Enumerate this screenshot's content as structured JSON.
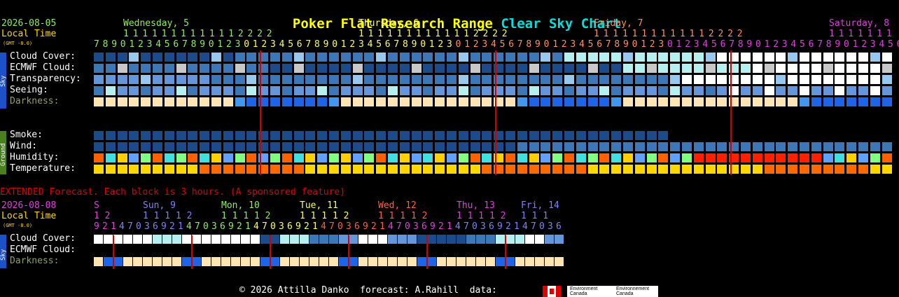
{
  "title": {
    "name": "Poker Flat Research Range",
    "suffix": "Clear Sky Chart",
    "name_color": "#ffff00",
    "suffix_color": "#00e0e0"
  },
  "date": "2026-08-05",
  "local_time_label": "Local Time",
  "gmt": "(GMT -8.0)",
  "days": [
    {
      "label": "Wednesday, 5",
      "color": "#90ee60"
    },
    {
      "label": "Thursday, 6",
      "color": "#ffff60"
    },
    {
      "label": "Friday, 7",
      "color": "#ff9060"
    },
    {
      "label": "Saturday, 8",
      "color": "#e040e0"
    }
  ],
  "hours_tens": [
    "1 1 1 1 1 1 1 1 1 1 1 1 2 2 2 2",
    "1 1 1 1 1 1 1 1 1 1 1 1 2 2 2 2",
    "1 1 1 1 1 1 1 1 1 1 1 1 2 2 2 2",
    "1 1 1 1 1 1 1"
  ],
  "hours_ones": "78901234567890123012345678901234567890123012345678901234567890123012345678901234567890123456",
  "sky_sidebar_label": "Sky",
  "ground_sidebar_label": "Ground",
  "rows_sky": [
    "Cloud Cover:",
    "ECMWF Cloud:",
    "Transparency:",
    "Seeing:",
    "Darkness:"
  ],
  "rows_ground": [
    "Smoke:",
    "Wind:",
    "Humidity:",
    "Temperature:"
  ],
  "extended_note": "EXTENDED Forecast. Each block is 3 hours. (A sponsored feature)",
  "ext_date": "2026-08-08",
  "ext_days": [
    {
      "label": "S",
      "color": "#e040e0"
    },
    {
      "label": "Sun, 9",
      "color": "#8080ff"
    },
    {
      "label": "Mon, 10",
      "color": "#90ee60"
    },
    {
      "label": "Tue, 11",
      "color": "#ffff60"
    },
    {
      "label": "Wed, 12",
      "color": "#ff6040"
    },
    {
      "label": "Thu, 13",
      "color": "#e040e0"
    },
    {
      "label": "Fri, 14",
      "color": "#8080ff"
    }
  ],
  "ext_tens": [
    "1 2",
    "1 1 1 1 2",
    "1 1 1 1 2",
    "1 1 1 1 2",
    "1 1 1 1 2",
    "1 1 1 1 2",
    "1 1 1"
  ],
  "ext_ones": "92147036921470369214703692147036921470369214703692147036",
  "ext_rows": [
    "Cloud Cover:",
    "ECMWF Cloud:",
    "Darkness:"
  ],
  "footer": {
    "copyright": "© 2026 Attilla Danko  forecast: A.Rahill  data:",
    "env_canada_1": "Environment Canada",
    "env_canada_2": "Environnement Canada"
  },
  "palette": {
    "dark_blue": "#1c4b8c",
    "mid_blue": "#3c78b8",
    "light_blue": "#6496dc",
    "pale_blue": "#96c8f0",
    "cyan": "#b4f0f0",
    "white": "#ffffff",
    "grey": "#c8c8c8",
    "dark_teal": "#2c5ca0",
    "peach": "#ffe4b4",
    "bright_blue": "#1e64e6",
    "sky_blue": "#4196f0",
    "orange": "#ff6a00",
    "yellow": "#ffd700",
    "red_line": "#d00000"
  }
}
